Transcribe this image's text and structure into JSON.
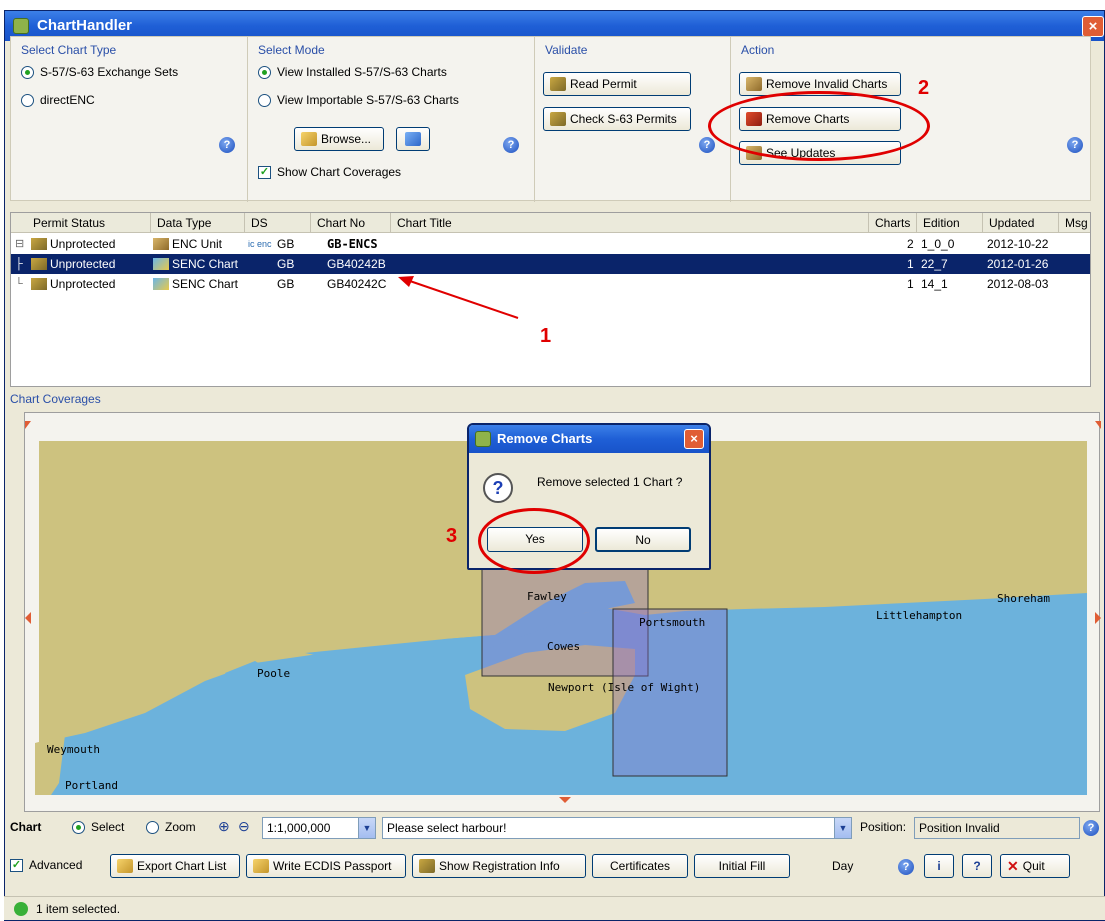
{
  "window": {
    "title": "ChartHandler",
    "close": "×"
  },
  "chart_type": {
    "title": "Select Chart Type",
    "options": [
      "S-57/S-63 Exchange Sets",
      "directENC"
    ]
  },
  "mode": {
    "title": "Select Mode",
    "options": [
      "View Installed S-57/S-63 Charts",
      "View Importable S-57/S-63 Charts"
    ],
    "browse": "Browse...",
    "show_coverages": "Show Chart Coverages"
  },
  "validate": {
    "title": "Validate",
    "read_permit": "Read Permit",
    "check_permits": "Check S-63 Permits"
  },
  "action": {
    "title": "Action",
    "remove_invalid": "Remove Invalid Charts",
    "remove_charts": "Remove Charts",
    "see_updates": "See Updates"
  },
  "table": {
    "headers": [
      "Permit Status",
      "Data Type",
      "DS",
      "Chart No",
      "Chart Title",
      "Charts",
      "Edition",
      "Updated",
      "Msg"
    ],
    "rows": [
      {
        "tree": "⊟",
        "permit": "Unprotected",
        "type": "ENC Unit",
        "ds_icon": "ic enc",
        "ds": "GB",
        "chart_no": "GB-ENCS",
        "charts": "2",
        "edition": "1_0_0",
        "updated": "2012-10-22"
      },
      {
        "tree": "├",
        "permit": "Unprotected",
        "type": "SENC Chart",
        "ds_icon": "",
        "ds": "GB",
        "chart_no": "GB40242B",
        "charts": "1",
        "edition": "22_7",
        "updated": "2012-01-26"
      },
      {
        "tree": "└",
        "permit": "Unprotected",
        "type": "SENC Chart",
        "ds_icon": "",
        "ds": "GB",
        "chart_no": "GB40242C",
        "charts": "1",
        "edition": "14_1",
        "updated": "2012-08-03"
      }
    ]
  },
  "coverage": {
    "title": "Chart Coverages",
    "places": [
      "Fawley",
      "Portsmouth",
      "Cowes",
      "Newport (Isle of Wight)",
      "Poole",
      "Weymouth",
      "Portland",
      "Littlehampton",
      "Shoreham"
    ]
  },
  "dialog": {
    "title": "Remove Charts",
    "message": "Remove selected 1 Chart ?",
    "yes": "Yes",
    "no": "No",
    "icon": "?"
  },
  "toolbar": {
    "chart_label": "Chart",
    "select": "Select",
    "zoom": "Zoom",
    "scale": "1:1,000,000",
    "harbour": "Please select harbour!",
    "position_label": "Position:",
    "position": "Position Invalid",
    "advanced": "Advanced",
    "export": "Export Chart List",
    "passport": "Write ECDIS Passport",
    "registration": "Show Registration Info",
    "certificates": "Certificates",
    "initial_fill": "Initial Fill",
    "day": "Day",
    "quit": "Quit"
  },
  "status": {
    "text": "1 item selected."
  },
  "annotations": {
    "a1": "1",
    "a2": "2",
    "a3": "3"
  },
  "colors": {
    "land": "#cdc27f",
    "sea": "#6cb2dc",
    "selection": "#0a246a",
    "annotation": "#e00000"
  }
}
